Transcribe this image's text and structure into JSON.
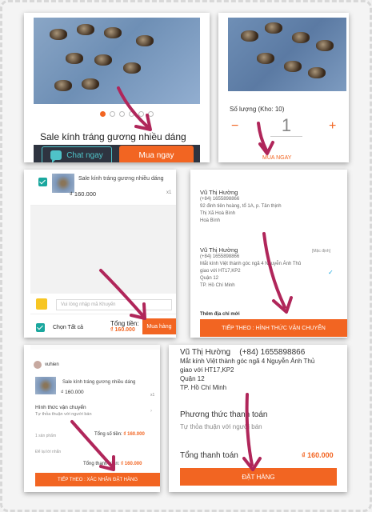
{
  "panel1": {
    "product_title": "Sale kính tráng gương nhiều dáng",
    "chat_label": "Chat ngay",
    "buy_now_label": "Mua ngay",
    "active_image_index": 1
  },
  "panel2": {
    "quantity_label": "Số lượng (Kho: 10)",
    "minus": "−",
    "quantity": "1",
    "plus": "+",
    "buy_now_label": "MUA NGAY"
  },
  "panel3": {
    "product_name": "Sale kính tráng gương nhiều dáng",
    "price": "₫ 160.000",
    "qty": "x1",
    "voucher_placeholder": "Vui lòng nhập mã Khuyến",
    "select_all": "Chọn Tất cả",
    "total_label": "Tổng tiền:",
    "total_value": "₫ 160.000",
    "buy_label": "Mua hàng"
  },
  "panel4": {
    "address1": {
      "name": "Vũ Thị Hường",
      "phone": "(+84) 1655898866",
      "line1": "92 đinh tiên hoàng, tổ 1A, p. Tân thịnh",
      "line2": "Thị Xã Hoà Bình",
      "line3": "Hoà Bình"
    },
    "address2": {
      "name": "Vũ Thị Hường",
      "default_tag": "[Mặc định]",
      "phone": "(+84) 1655898866",
      "line1": "Mắt kính Việt thành góc ngã 4 Nguyễn Ánh Thủ",
      "line2": "giao với HT17,KP2",
      "line3": "Quận 12",
      "line4": "TP. Hồ Chí Minh"
    },
    "add_address": "Thêm địa chỉ mới",
    "next_label": "TIẾP THEO : HÌNH THỨC VẬN CHUYỂN"
  },
  "panel5": {
    "seller": "vuhien",
    "product_name": "Sale kính tráng gương nhiều dáng",
    "price": "₫ 160.000",
    "qty": "x1",
    "shipping_label": "Hình thức vận chuyển",
    "shipping_value": "Tự thỏa thuận với người bán",
    "items_count": "1 sản phẩm",
    "subtotal_label": "Tổng số tiền:",
    "subtotal_value": "₫ 160.000",
    "note": "Để lại lời nhắn",
    "total_label": "Tổng thanh toán:",
    "total_value": "₫ 160.000",
    "next_label": "TIẾP THEO : XÁC NHẬN ĐẶT HÀNG"
  },
  "panel6": {
    "name": "Vũ Thị Hường",
    "phone": "(+84) 1655898866",
    "line1": "Mắt kính Việt thành góc ngã 4 Nguyễn Ánh Thủ",
    "line2": "giao với HT17,KP2",
    "line3": "Quận 12",
    "line4": "TP. Hồ Chí Minh",
    "payment_method_label": "Phương thức thanh toán",
    "payment_method_value": "Tự thỏa thuận với người bán",
    "total_label": "Tổng thanh toán",
    "total_value": "₫ 160.000",
    "place_order_label": "ĐẶT HÀNG"
  },
  "colors": {
    "accent": "#f26522",
    "dark_bar": "#2e3440",
    "chat": "#4fc3c8",
    "arrow": "#b0265a",
    "check": "#1aa79e"
  }
}
